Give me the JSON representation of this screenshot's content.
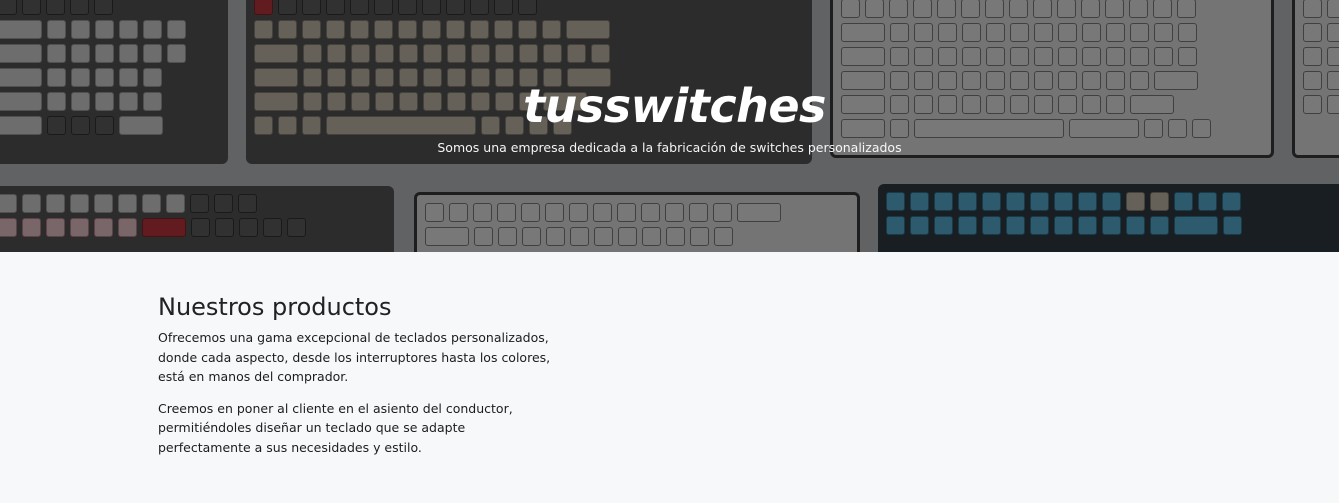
{
  "hero": {
    "title": "tusswitches",
    "subtitle": "Somos una empresa dedicada a la fabricación de switches personalizados"
  },
  "products": {
    "heading": "Nuestros productos",
    "paragraphs": [
      "Ofrecemos una gama excepcional de teclados personalizados, donde cada aspecto, desde los interruptores hasta los colores, está en manos del comprador.",
      "Creemos en poner al cliente en el asiento del conductor, permitiéndoles diseñar un teclado que se adapte perfectamente a sus necesidades y estilo."
    ]
  },
  "colors": {
    "page_background": "#f7f8fa",
    "hero_overlay": "rgba(20,20,22,0.55)",
    "text": "#1e1f21"
  }
}
